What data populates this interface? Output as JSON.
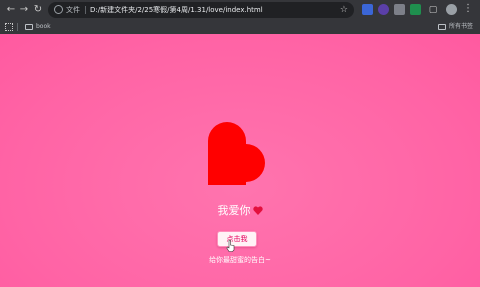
{
  "browser": {
    "omnibox_label": "文件",
    "url": "D:/新建文件夹/2/25寒假/第4周/1.31/love/index.html",
    "bookmarks": [
      {
        "label": "book"
      },
      {
        "label": "所有书签"
      }
    ]
  },
  "page": {
    "title": "我爱你",
    "button_label": "点击我",
    "subtitle": "给你最甜蜜的告白~"
  },
  "colors": {
    "background": "#ff6aa9",
    "heart": "#ff0000",
    "button_text": "#e6005c"
  },
  "icons": [
    "back-arrow-icon",
    "forward-arrow-icon",
    "reload-icon",
    "info-icon",
    "star-icon",
    "heart-icon",
    "cursor-icon",
    "folder-icon",
    "menu-icon"
  ]
}
